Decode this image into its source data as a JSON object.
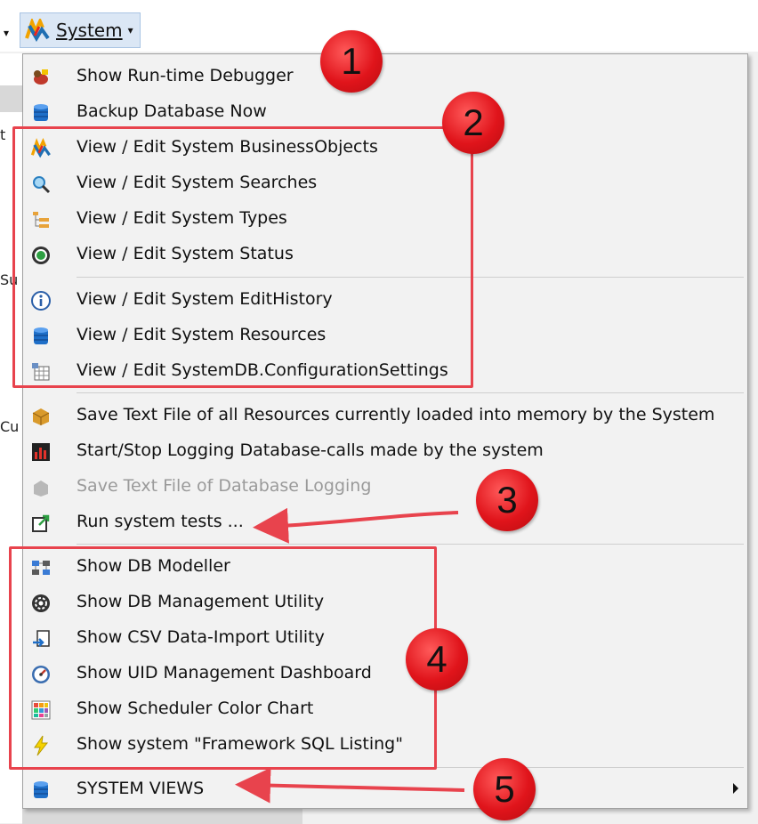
{
  "toolbar": {
    "system_label": "System"
  },
  "menu": {
    "items": [
      {
        "label": "Show Run-time Debugger",
        "icon": "debugger-icon"
      },
      {
        "label": "Backup Database Now",
        "icon": "database-icon"
      },
      {
        "label": "View / Edit System BusinessObjects",
        "icon": "system-logo-icon"
      },
      {
        "label": "View / Edit System Searches",
        "icon": "magnifier-icon"
      },
      {
        "label": "View / Edit System Types",
        "icon": "tree-icon"
      },
      {
        "label": "View / Edit System Status",
        "icon": "status-target-icon"
      },
      {
        "label": "View / Edit System EditHistory",
        "icon": "info-icon"
      },
      {
        "label": "View / Edit System Resources",
        "icon": "database-icon"
      },
      {
        "label": "View / Edit SystemDB.ConfigurationSettings",
        "icon": "config-grid-icon"
      },
      {
        "label": "Save Text File of all Resources currently loaded into memory by the System",
        "icon": "box-icon"
      },
      {
        "label": "Start/Stop Logging Database-calls made by the system",
        "icon": "bar-chart-icon"
      },
      {
        "label": "Save Text File of Database Logging",
        "icon": "disabled-shape-icon",
        "disabled": true
      },
      {
        "label": "Run system tests ...",
        "icon": "export-icon"
      },
      {
        "label": "Show DB Modeller",
        "icon": "modeller-icon"
      },
      {
        "label": "Show DB Management Utility",
        "icon": "gear-icon"
      },
      {
        "label": "Show CSV Data-Import Utility",
        "icon": "import-icon"
      },
      {
        "label": "Show UID Management Dashboard",
        "icon": "gauge-icon"
      },
      {
        "label": "Show Scheduler Color Chart",
        "icon": "color-grid-icon"
      },
      {
        "label": "Show system \"Framework SQL Listing\"",
        "icon": "lightning-icon"
      },
      {
        "label": "SYSTEM VIEWS",
        "icon": "database-icon",
        "submenu": true
      }
    ]
  },
  "annotations": {
    "badges": [
      "1",
      "2",
      "3",
      "4",
      "5"
    ],
    "color": "#e8434d"
  },
  "background": {
    "edge_letters": [
      "t",
      "Su",
      "Cu"
    ]
  }
}
